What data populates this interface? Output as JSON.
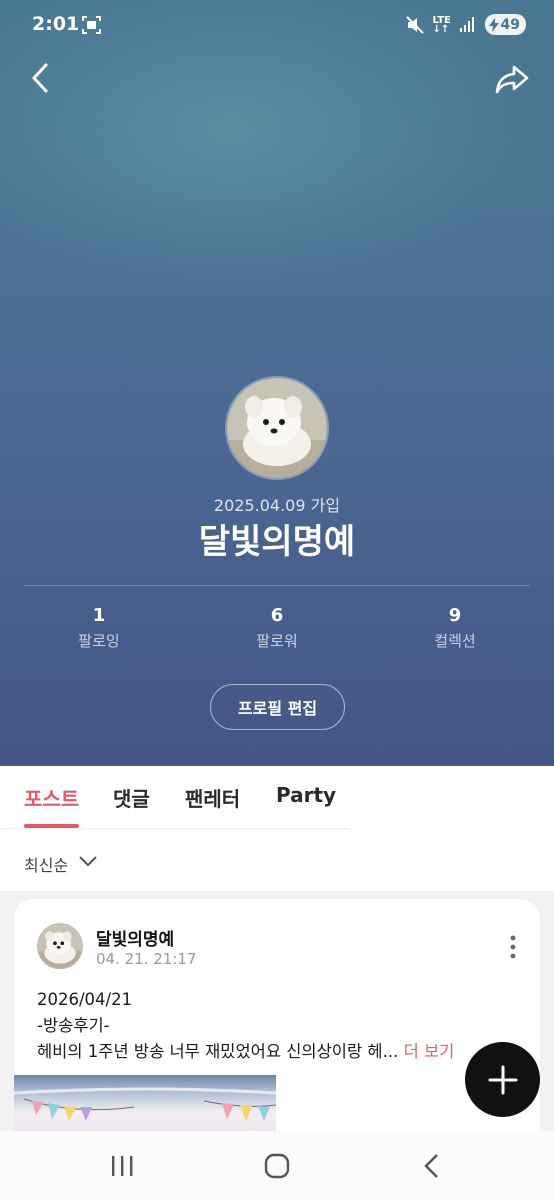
{
  "status": {
    "time": "2:01",
    "network": "LTE",
    "battery": "49",
    "icons": [
      "screen-recorder-icon",
      "mute-icon",
      "lte-icon",
      "signal-icon",
      "battery-charging-icon"
    ]
  },
  "header": {
    "back_icon": "chevron-left-icon",
    "share_icon": "share-arrow-icon"
  },
  "profile": {
    "join_date": "2025.04.09 가입",
    "name": "달빛의명예",
    "stats": [
      {
        "value": "1",
        "label": "팔로잉"
      },
      {
        "value": "6",
        "label": "팔로워"
      },
      {
        "value": "9",
        "label": "컬렉션"
      }
    ],
    "edit_button": "프로필 편집"
  },
  "tabs": [
    {
      "label": "포스트",
      "active": true
    },
    {
      "label": "댓글",
      "active": false
    },
    {
      "label": "팬레터",
      "active": false
    },
    {
      "label": "Party",
      "active": false
    }
  ],
  "sort": {
    "label": "최신순",
    "icon": "chevron-down-icon"
  },
  "post": {
    "author": "달빛의명예",
    "time": "04. 21. 21:17",
    "lines": [
      "2026/04/21",
      "-방송후기-",
      "헤비의 1주년 방송 너무 재밌었어요 신의상이랑 헤..."
    ],
    "more_label": "더 보기"
  },
  "fab": {
    "icon": "plus-icon"
  },
  "nav": {
    "icons": [
      "recents-icon",
      "home-icon",
      "back-icon"
    ]
  },
  "colors": {
    "accent": "#e05b6a",
    "hero_top": "#4a7792",
    "hero_bottom": "#435685"
  }
}
